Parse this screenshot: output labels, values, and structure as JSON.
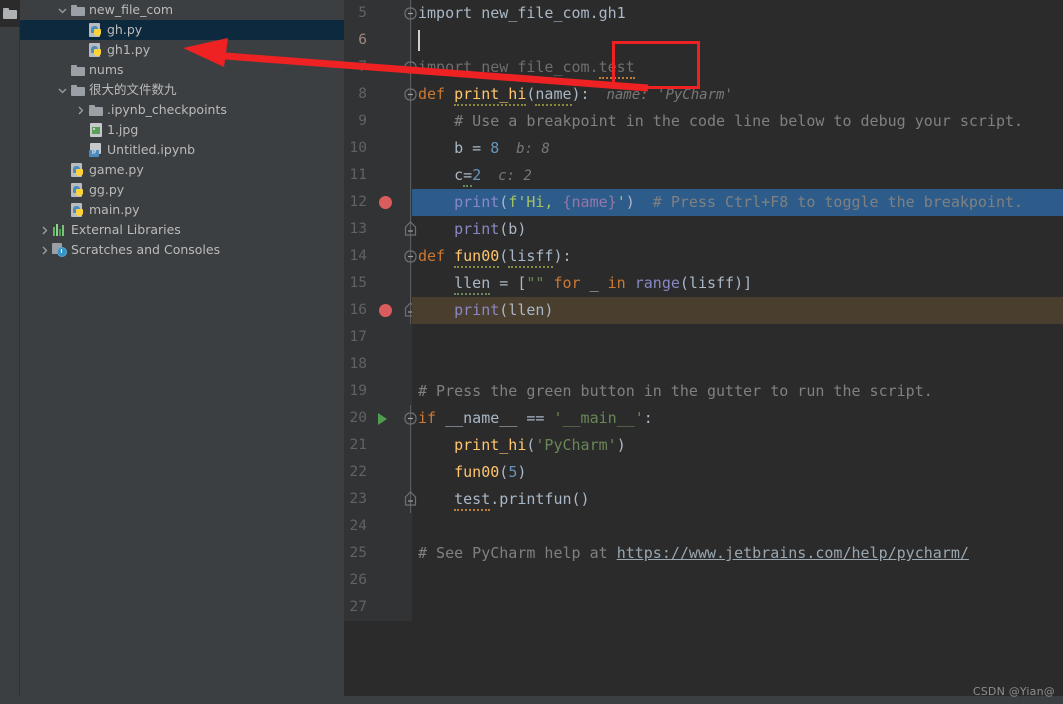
{
  "toolstrip": {
    "project_icon": "folder-icon"
  },
  "sidebar": {
    "items": [
      {
        "label": "new_file_com",
        "icon": "folder-icon",
        "indent": 2,
        "arrow": "chevron-down",
        "selected": false,
        "type": "folder"
      },
      {
        "label": "gh.py",
        "icon": "python-file-icon",
        "indent": 3,
        "arrow": "",
        "selected": true,
        "type": "python"
      },
      {
        "label": "gh1.py",
        "icon": "python-file-icon",
        "indent": 3,
        "arrow": "",
        "selected": false,
        "type": "python"
      },
      {
        "label": "nums",
        "icon": "folder-icon",
        "indent": 2,
        "arrow": "",
        "selected": false,
        "type": "folder"
      },
      {
        "label": "很大的文件数九",
        "icon": "folder-icon",
        "indent": 2,
        "arrow": "chevron-down",
        "selected": false,
        "type": "folder"
      },
      {
        "label": ".ipynb_checkpoints",
        "icon": "folder-icon",
        "indent": 3,
        "arrow": "chevron-right",
        "selected": false,
        "type": "folder"
      },
      {
        "label": "1.jpg",
        "icon": "image-file-icon",
        "indent": 3,
        "arrow": "",
        "selected": false,
        "type": "image"
      },
      {
        "label": "Untitled.ipynb",
        "icon": "notebook-file-icon",
        "indent": 3,
        "arrow": "",
        "selected": false,
        "type": "notebook"
      },
      {
        "label": "game.py",
        "icon": "python-file-icon",
        "indent": 2,
        "arrow": "",
        "selected": false,
        "type": "python"
      },
      {
        "label": "gg.py",
        "icon": "python-file-icon",
        "indent": 2,
        "arrow": "",
        "selected": false,
        "type": "python"
      },
      {
        "label": "main.py",
        "icon": "python-file-icon",
        "indent": 2,
        "arrow": "",
        "selected": false,
        "type": "python"
      },
      {
        "label": "External Libraries",
        "icon": "libraries-icon",
        "indent": 1,
        "arrow": "chevron-right",
        "selected": false,
        "type": "libs"
      },
      {
        "label": "Scratches and Consoles",
        "icon": "scratches-icon",
        "indent": 1,
        "arrow": "chevron-right",
        "selected": false,
        "type": "scratch"
      }
    ]
  },
  "editor": {
    "lines": [
      {
        "num": "5",
        "text": "import new_file_com.gh1"
      },
      {
        "num": "6",
        "text": ""
      },
      {
        "num": "7",
        "text": "import new_file_com.test"
      },
      {
        "num": "8",
        "text": "def print_hi(name):",
        "inlay": "name: 'PyCharm'"
      },
      {
        "num": "9",
        "text": "    # Use a breakpoint in the code line below to debug your script."
      },
      {
        "num": "10",
        "text": "    b = 8",
        "inlay": "b: 8"
      },
      {
        "num": "11",
        "text": "    c=2",
        "inlay": "c: 2"
      },
      {
        "num": "12",
        "text": "    print(f'Hi, {name}')  # Press Ctrl+F8 to toggle the breakpoint."
      },
      {
        "num": "13",
        "text": "    print(b)"
      },
      {
        "num": "14",
        "text": "def fun00(lisff):"
      },
      {
        "num": "15",
        "text": "    llen = [\"\" for _ in range(lisff)]"
      },
      {
        "num": "16",
        "text": "    print(llen)"
      },
      {
        "num": "17",
        "text": ""
      },
      {
        "num": "18",
        "text": ""
      },
      {
        "num": "19",
        "text": "# Press the green button in the gutter to run the script."
      },
      {
        "num": "20",
        "text": "if __name__ == '__main__':"
      },
      {
        "num": "21",
        "text": "    print_hi('PyCharm')"
      },
      {
        "num": "22",
        "text": "    fun00(5)"
      },
      {
        "num": "23",
        "text": "    test.printfun()"
      },
      {
        "num": "24",
        "text": ""
      },
      {
        "num": "25",
        "text": "# See PyCharm help at https://www.jetbrains.com/help/pycharm/"
      },
      {
        "num": "26",
        "text": ""
      },
      {
        "num": "27",
        "text": ""
      }
    ],
    "breakpoint_lines": [
      "12",
      "16"
    ],
    "run_arrow_line": "20",
    "selected_line": "12",
    "current_line": "6",
    "help_url": "https://www.jetbrains.com/help/pycharm/"
  },
  "annotations": {
    "highlight_box_target": "test",
    "arrow_color": "#ee2222",
    "box_color": "#ee2222"
  },
  "watermark": {
    "text": "CSDN @Yian@"
  },
  "colors": {
    "sidebar_bg": "#3c3f41",
    "editor_bg": "#2b2b2b",
    "gutter_bg": "#313335",
    "selection": "#2e5c8a",
    "breakpoint_line": "#4a3f2f",
    "selected_tree_row": "#0d293e",
    "breakpoint_dot": "#db5c5c",
    "run_arrow": "#4f9e4f"
  }
}
